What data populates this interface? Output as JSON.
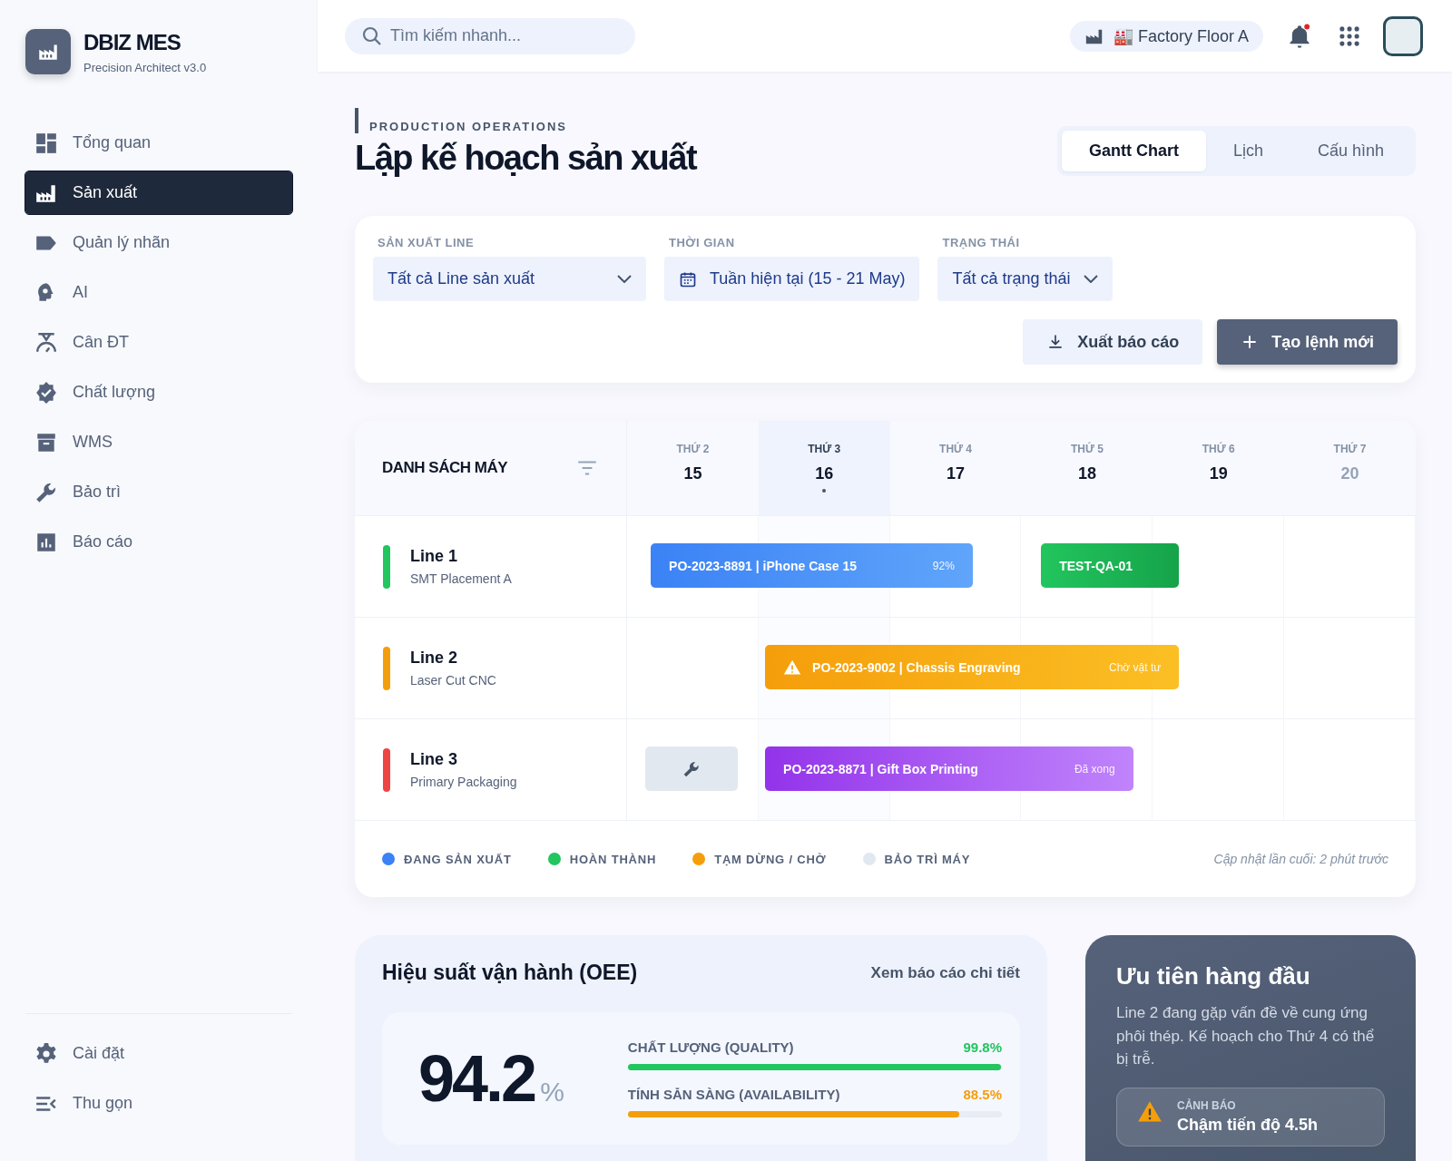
{
  "brand": {
    "name": "DBIZ MES",
    "subtitle": "Precision Architect v3.0"
  },
  "sidebar": {
    "items": [
      {
        "label": "Tổng quan",
        "selected": false
      },
      {
        "label": "Sản xuất",
        "selected": true
      },
      {
        "label": "Quản lý nhãn",
        "selected": false
      },
      {
        "label": "AI",
        "selected": false
      },
      {
        "label": "Cân ĐT",
        "selected": false
      },
      {
        "label": "Chất lượng",
        "selected": false
      },
      {
        "label": "WMS",
        "selected": false
      },
      {
        "label": "Bảo trì",
        "selected": false
      },
      {
        "label": "Báo cáo",
        "selected": false
      }
    ],
    "footer_items": [
      {
        "label": "Cài đặt"
      },
      {
        "label": "Thu gọn"
      }
    ]
  },
  "topbar": {
    "search": {
      "placeholder": "Tìm kiếm nhanh..."
    },
    "location": "🏭 Factory Floor A",
    "notification": true
  },
  "page": {
    "eyebrow": "PRODUCTION OPERATIONS",
    "title": "Lập kế hoạch sản xuất",
    "tabs": [
      {
        "label": "Gantt Chart",
        "selected": true
      },
      {
        "label": "Lịch",
        "selected": false
      },
      {
        "label": "Cấu hình",
        "selected": false
      }
    ]
  },
  "filters": [
    {
      "label": "SẢN XUẤT LINE",
      "value": "Tất cả Line sản xuất",
      "kind": "select"
    },
    {
      "label": "THỜI GIAN",
      "value": "Tuần hiện tại (15 - 21 May)",
      "kind": "date"
    },
    {
      "label": "TRẠNG THÁI",
      "value": "Tất cả trạng thái",
      "kind": "select"
    }
  ],
  "actions": [
    {
      "label": "Xuất báo cáo",
      "kind": "export"
    },
    {
      "label": "Tạo lệnh mới",
      "kind": "create"
    }
  ],
  "gantt": {
    "title": "DANH SÁCH MÁY",
    "days": [
      {
        "weekday": "THỨ 2",
        "date": "15",
        "selected": false,
        "dimmed": false
      },
      {
        "weekday": "THỨ 3",
        "date": "16",
        "selected": true,
        "dimmed": false
      },
      {
        "weekday": "THỨ 4",
        "date": "17",
        "selected": false,
        "dimmed": false
      },
      {
        "weekday": "THỨ 5",
        "date": "18",
        "selected": false,
        "dimmed": false
      },
      {
        "weekday": "THỨ 6",
        "date": "19",
        "selected": false,
        "dimmed": false
      },
      {
        "weekday": "THỨ 7",
        "date": "20",
        "selected": false,
        "dimmed": true
      }
    ],
    "lines": [
      {
        "name": "Line 1",
        "machine": "SMT Placement A",
        "color": "#22c55e",
        "tasks": [
          {
            "kind": "running",
            "label": "PO-2023-8891 | iPhone Case 15",
            "note": "92%"
          },
          {
            "kind": "done",
            "label": "TEST-QA-01"
          }
        ]
      },
      {
        "name": "Line 2",
        "machine": "Laser Cut CNC",
        "color": "#f59e0b",
        "tasks": [
          {
            "kind": "paused",
            "label": "PO-2023-9002 | Chassis Engraving",
            "note": "Chờ vật tư"
          }
        ]
      },
      {
        "name": "Line 3",
        "machine": "Primary Packaging",
        "color": "#ef4444",
        "tasks": [
          {
            "kind": "maintenance"
          },
          {
            "kind": "finished",
            "label": "PO-2023-8871 | Gift Box Printing",
            "note": "Đã xong"
          }
        ]
      }
    ],
    "legend": [
      {
        "label": "ĐANG SẢN XUẤT",
        "color": "#3b82f6"
      },
      {
        "label": "HOÀN THÀNH",
        "color": "#22c55e"
      },
      {
        "label": "TẠM DỪNG / CHỜ",
        "color": "#f59e0b"
      },
      {
        "label": "BẢO TRÌ MÁY",
        "color": "#e2e8f0"
      }
    ],
    "updated": "Cập nhật lần cuối: 2 phút trước"
  },
  "oee": {
    "title": "Hiệu suất vận hành (OEE)",
    "link": "Xem báo cáo chi tiết",
    "value": "94.2",
    "unit": "%",
    "metrics": [
      {
        "label": "CHẤT LƯỢNG (QUALITY)",
        "reading": "99.8%",
        "level": 0.998,
        "color": "#22c55e"
      },
      {
        "label": "TÍNH SẴN SÀNG (AVAILABILITY)",
        "reading": "88.5%",
        "level": 0.885,
        "color": "#f59e0b"
      }
    ]
  },
  "priority": {
    "title": "Ưu tiên hàng đầu",
    "text": "Line 2 đang gặp vấn đề về cung ứng phôi thép. Kế hoạch cho Thứ 4 có thể bị trễ.",
    "alert": {
      "label": "CẢNH BÁO",
      "text": "Chậm tiến độ 4.5h"
    }
  }
}
